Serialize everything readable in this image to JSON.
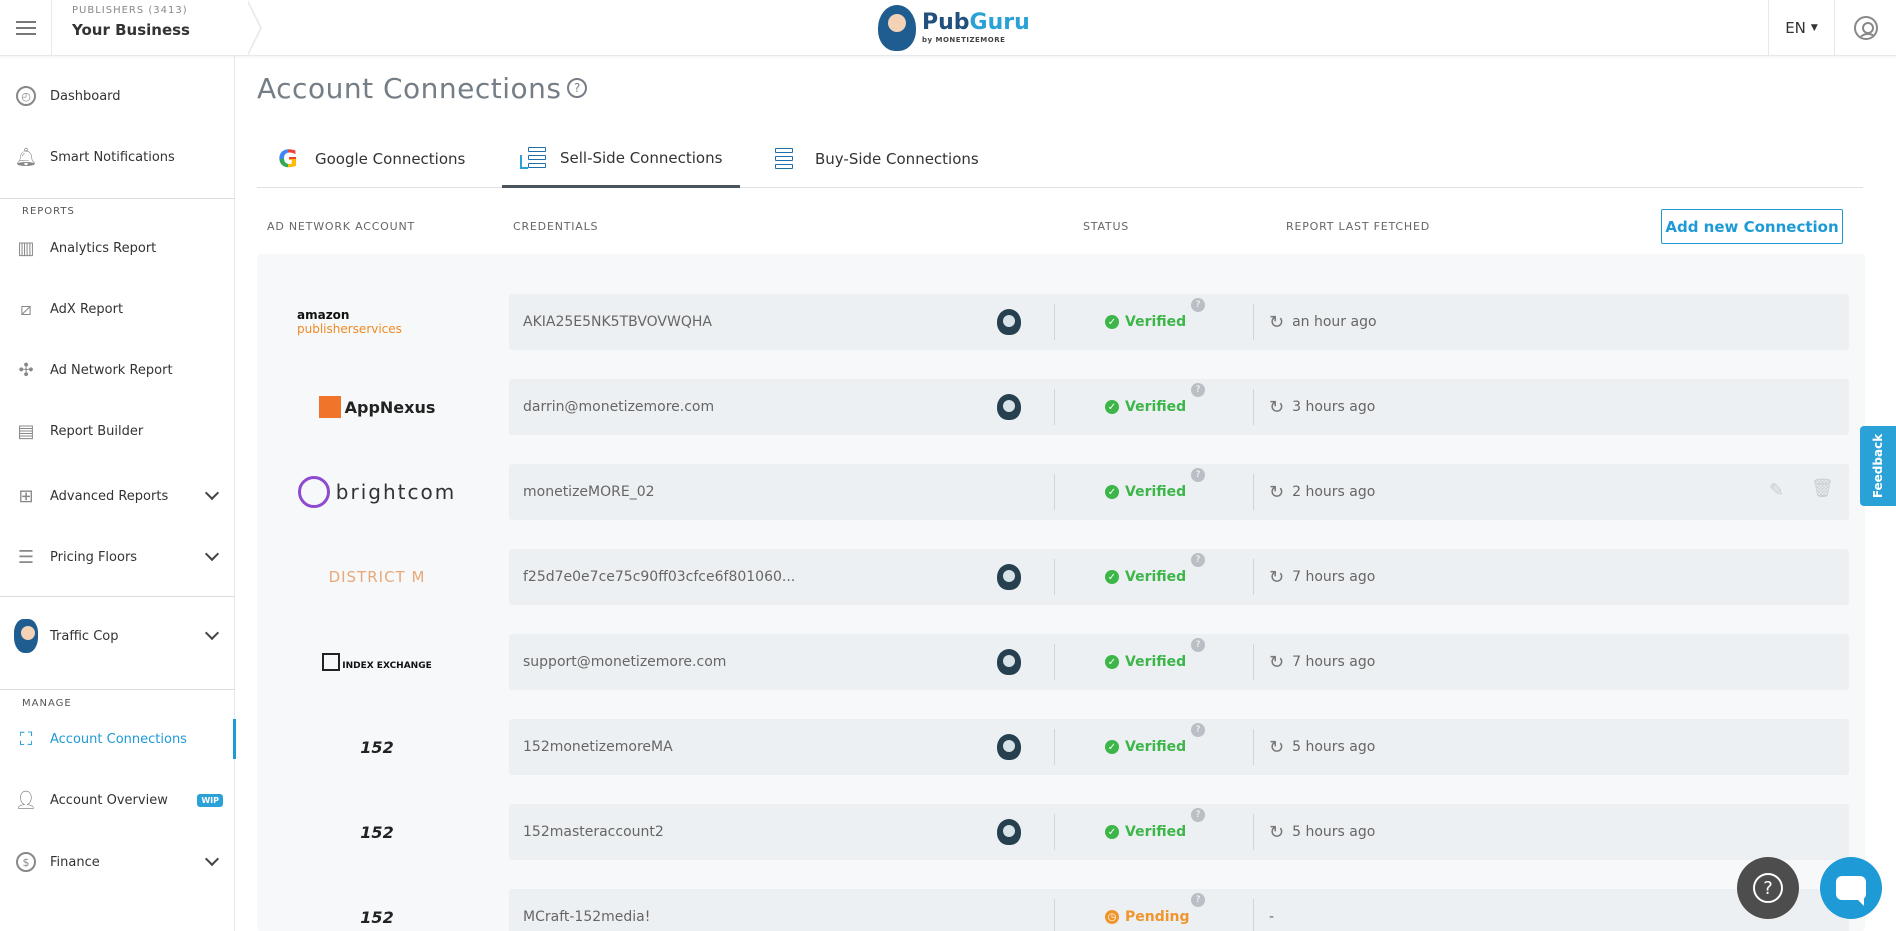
{
  "header": {
    "publishers_label": "PUBLISHERS (3413)",
    "business_name": "Your Business",
    "logo_text_pub": "Pub",
    "logo_text_guru": "Guru",
    "logo_sub": "by MONETIZEMORE",
    "language": "EN"
  },
  "sidebar": {
    "items": [
      {
        "label": "Dashboard",
        "icon": "gauge-icon"
      },
      {
        "label": "Smart Notifications",
        "icon": "bell-icon"
      },
      {
        "label": "Analytics Report",
        "icon": "bar-chart-icon"
      },
      {
        "label": "AdX Report",
        "icon": "adx-icon"
      },
      {
        "label": "Ad Network Report",
        "icon": "network-icon"
      },
      {
        "label": "Report Builder",
        "icon": "report-builder-icon"
      },
      {
        "label": "Advanced Reports",
        "icon": "grid-icon"
      },
      {
        "label": "Pricing Floors",
        "icon": "document-icon"
      },
      {
        "label": "Traffic Cop",
        "icon": "traffic-cop-avatar"
      },
      {
        "label": "Account Connections",
        "icon": "connections-icon"
      },
      {
        "label": "Account Overview",
        "icon": "user-icon",
        "badge": "WIP"
      },
      {
        "label": "Finance",
        "icon": "dollar-icon"
      }
    ],
    "section_reports": "REPORTS",
    "section_manage": "MANAGE"
  },
  "main": {
    "title": "Account Connections",
    "help_glyph": "?",
    "tabs": [
      {
        "label": "Google Connections",
        "icon": "google-icon"
      },
      {
        "label": "Sell-Side Connections",
        "icon": "sell-side-icon",
        "active": true
      },
      {
        "label": "Buy-Side Connections",
        "icon": "buy-side-icon"
      }
    ],
    "columns": {
      "account": "AD NETWORK ACCOUNT",
      "credentials": "CREDENTIALS",
      "status": "STATUS",
      "fetched": "REPORT LAST FETCHED"
    },
    "add_button": "Add new Connection",
    "rows": [
      {
        "logo": "amazon-publisher-services-logo",
        "logo_text_a": "amazon",
        "logo_text_b": "publisherservices",
        "credential": "AKIA25E5NK5TBVOVWQHA",
        "status": "Verified",
        "fetched": "an hour ago"
      },
      {
        "logo": "appnexus-logo",
        "logo_text_a": "AppNexus",
        "credential": "darrin@monetizemore.com",
        "status": "Verified",
        "fetched": "3 hours ago"
      },
      {
        "logo": "brightcom-logo",
        "logo_text_a": "brightcom",
        "credential": "monetizeMORE_02",
        "status": "Verified",
        "fetched": "2 hours ago"
      },
      {
        "logo": "district-m-logo",
        "logo_text_a": "DISTRICT M",
        "credential": "f25d7e0e7ce75c90ff03cfce6f801060...",
        "status": "Verified",
        "fetched": "7 hours ago"
      },
      {
        "logo": "index-exchange-logo",
        "logo_text_a": "INDEX EXCHANGE",
        "credential": "support@monetizemore.com",
        "status": "Verified",
        "fetched": "7 hours ago"
      },
      {
        "logo": "152-media-logo",
        "logo_text_a": "152",
        "credential": "152monetizemoreMA",
        "status": "Verified",
        "fetched": "5 hours ago"
      },
      {
        "logo": "152-media-logo",
        "logo_text_a": "152",
        "credential": "152masteraccount2",
        "status": "Verified",
        "fetched": "5 hours ago"
      },
      {
        "logo": "152-media-logo",
        "logo_text_a": "152",
        "credential": "MCraft-152media!",
        "status": "Pending",
        "fetched": "-"
      }
    ]
  },
  "feedback_label": "Feedback",
  "colors": {
    "accent": "#1e9ad6",
    "verified": "#3cb648",
    "pending": "#f0952c"
  }
}
